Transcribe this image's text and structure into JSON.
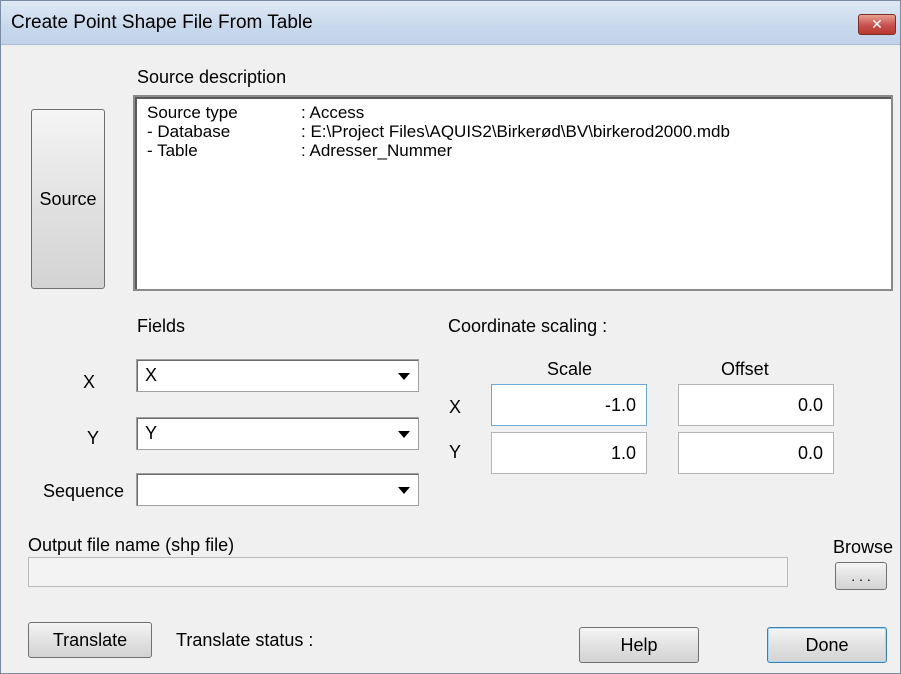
{
  "window": {
    "title": "Create Point Shape File From Table",
    "close_symbol": "✕"
  },
  "source": {
    "button_label": "Source",
    "description_label": "Source description",
    "rows": [
      {
        "key": "Source type",
        "value": ": Access"
      },
      {
        "key": " - Database",
        "value": ": E:\\Project Files\\AQUIS2\\Birkerød\\BV\\birkerod2000.mdb"
      },
      {
        "key": " - Table",
        "value": ": Adresser_Nummer"
      }
    ]
  },
  "fields": {
    "label": "Fields",
    "x_label": "X",
    "y_label": "Y",
    "sequence_label": "Sequence",
    "x_value": "X",
    "y_value": "Y",
    "sequence_value": ""
  },
  "scaling": {
    "label": "Coordinate scaling :",
    "scale_header": "Scale",
    "offset_header": "Offset",
    "x_label": "X",
    "y_label": "Y",
    "x_scale": "-1.0",
    "x_offset": "0.0",
    "y_scale": "1.0",
    "y_offset": "0.0"
  },
  "output": {
    "label": "Output file name (shp file)",
    "value": "",
    "browse_label": "Browse",
    "browse_button": ". . ."
  },
  "footer": {
    "translate_button": "Translate",
    "status_label": "Translate status :",
    "help_button": "Help",
    "done_button": "Done"
  }
}
